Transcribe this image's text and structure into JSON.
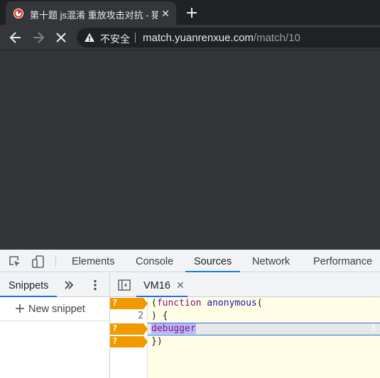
{
  "browser": {
    "tab": {
      "title": "第十题 js混淆 重放攻击对抗 - 猿人学",
      "close_icon": "close-icon"
    },
    "new_tab_icon": "plus-icon",
    "address": {
      "security_label": "不安全",
      "url_host": "match.yuanrenxue.com",
      "url_path": "/match/10"
    }
  },
  "devtools": {
    "tabs": [
      "Elements",
      "Console",
      "Sources",
      "Network",
      "Performance"
    ],
    "active_tab": "Sources",
    "navigator": {
      "tab": "Snippets",
      "new_snippet": "New snippet"
    },
    "editor": {
      "file_tab": "VM16",
      "close_glyph": "✕",
      "lines": [
        {
          "num": "1",
          "breakpoint": "?",
          "text_punct_open": "(",
          "text_kw": "function",
          "text_fn": "anonymous",
          "text_tail": "("
        },
        {
          "num": "2",
          "text": ") {"
        },
        {
          "num": "3",
          "breakpoint": "?",
          "text": "debugger"
        },
        {
          "num": "4",
          "breakpoint": "?",
          "text": "})"
        }
      ]
    }
  },
  "colors": {
    "accent": "#1a73e8",
    "breakpoint": "#f29900",
    "code_bg": "#fffde6"
  }
}
